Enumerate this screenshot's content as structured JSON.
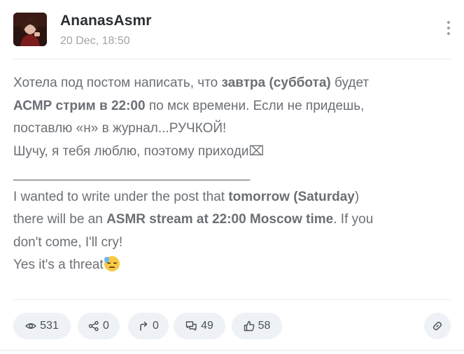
{
  "post": {
    "author": "AnanasAsmr",
    "date": "20 Dec, 18:50",
    "lines": {
      "l1_a": "Хотела под постом написать, что ",
      "l1_b": "завтра (суббота)",
      "l1_c": " будет",
      "l2_a": "АСМР стрим в 22:00",
      "l2_b": " по мск времени. Если не придешь,",
      "l3": "поставлю «н» в журнал...РУЧКОЙ!",
      "l4": "Шучу, я тебя люблю, поэтому приходи⌧",
      "l5": "________________________________",
      "l6_a": "I wanted to write under the post that ",
      "l6_b": "tomorrow (Saturday",
      "l6_c": ")",
      "l7_a": "there will be an ",
      "l7_b": "ASMR stream at 22:00 Moscow time",
      "l7_c": ". If you",
      "l8": "don't come, I'll cry!",
      "l9": "Yes it's a threat"
    }
  },
  "stats": {
    "views": "531",
    "shares": "0",
    "reposts": "0",
    "comments": "49",
    "likes": "58"
  },
  "icons": {
    "menu": "kebab-menu-icon",
    "views": "eye-icon",
    "shares": "share-icon",
    "reposts": "repost-arrow-icon",
    "comments": "comments-icon",
    "likes": "thumbs-up-icon",
    "link": "link-icon",
    "emoji": "anxious-sweat-face-emoji"
  }
}
